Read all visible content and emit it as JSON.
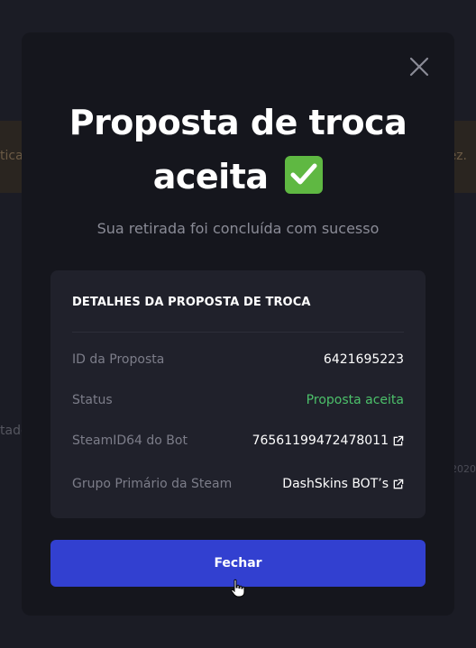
{
  "background": {
    "fragment_left": "tica",
    "fragment_right": "ez.",
    "fragment_left2": "tado",
    "fragment_right2": "2020"
  },
  "modal": {
    "title_line1": "Proposta de troca",
    "title_line2": "aceita",
    "subtitle": "Sua retirada foi concluída com sucesso",
    "close_icon": "close-icon",
    "details": {
      "heading": "DETALHES DA PROPOSTA DE TROCA",
      "rows": [
        {
          "label": "ID da Proposta",
          "value": "6421695223"
        },
        {
          "label": "Status",
          "value": "Proposta aceita"
        },
        {
          "label": "SteamID64 do Bot",
          "value": "76561199472478011"
        },
        {
          "label": "Grupo Primário da Steam",
          "value": "DashSkins BOT’s"
        }
      ]
    },
    "close_button_label": "Fechar"
  },
  "colors": {
    "accent": "#3240d0",
    "success": "#4cc06a",
    "modal_bg": "#15161d",
    "panel_bg": "#20212b"
  }
}
